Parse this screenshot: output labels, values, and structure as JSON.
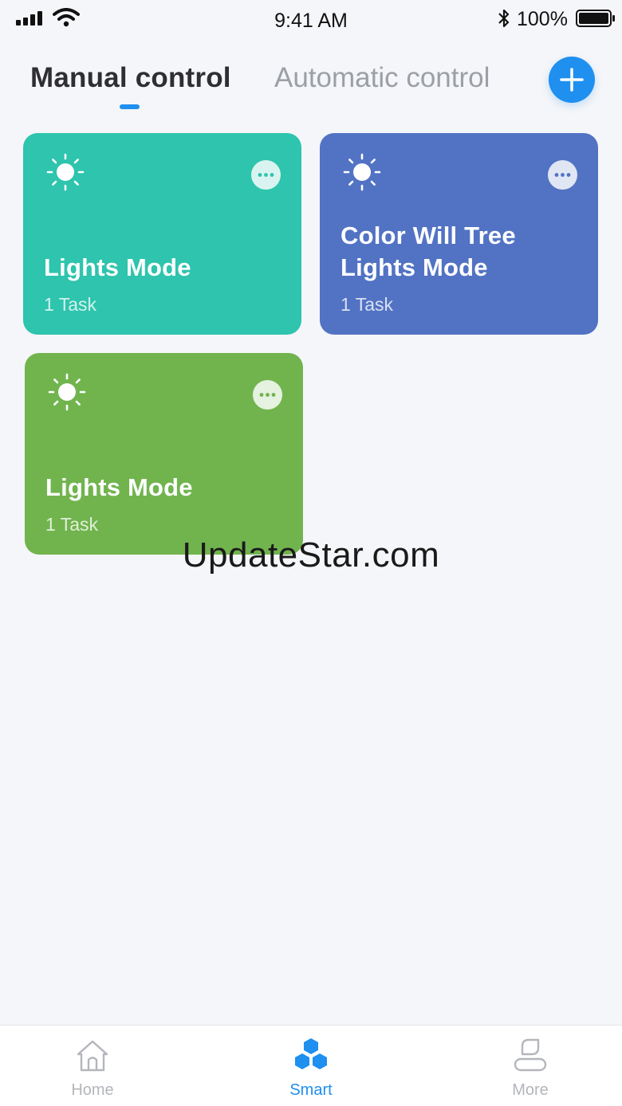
{
  "status_bar": {
    "time": "9:41 AM",
    "battery_percent": "100%",
    "battery_level": 1.0,
    "icons": [
      "signal-icon",
      "wifi-icon",
      "bluetooth-icon",
      "battery-icon"
    ]
  },
  "tabs": {
    "manual_label": "Manual control",
    "automatic_label": "Automatic control",
    "active": "manual",
    "accent_color": "#1f8ff0"
  },
  "add_button": {
    "icon": "plus-icon"
  },
  "cards": [
    {
      "title": "Lights Mode",
      "subtitle": "1 Task",
      "color": "#2ec4ad",
      "icon": "sun-icon"
    },
    {
      "title": "Color Will Tree Lights Mode",
      "subtitle": "1 Task",
      "color": "#5273c4",
      "icon": "sun-icon"
    },
    {
      "title": "Lights Mode",
      "subtitle": "1 Task",
      "color": "#71b44e",
      "icon": "sun-icon"
    }
  ],
  "watermark": "UpdateStar.com",
  "bottom_nav": {
    "items": [
      {
        "label": "Home",
        "icon": "home-icon"
      },
      {
        "label": "Smart",
        "icon": "smart-hexagon-icon"
      },
      {
        "label": "More",
        "icon": "more-profile-icon"
      }
    ],
    "active": "Smart"
  }
}
